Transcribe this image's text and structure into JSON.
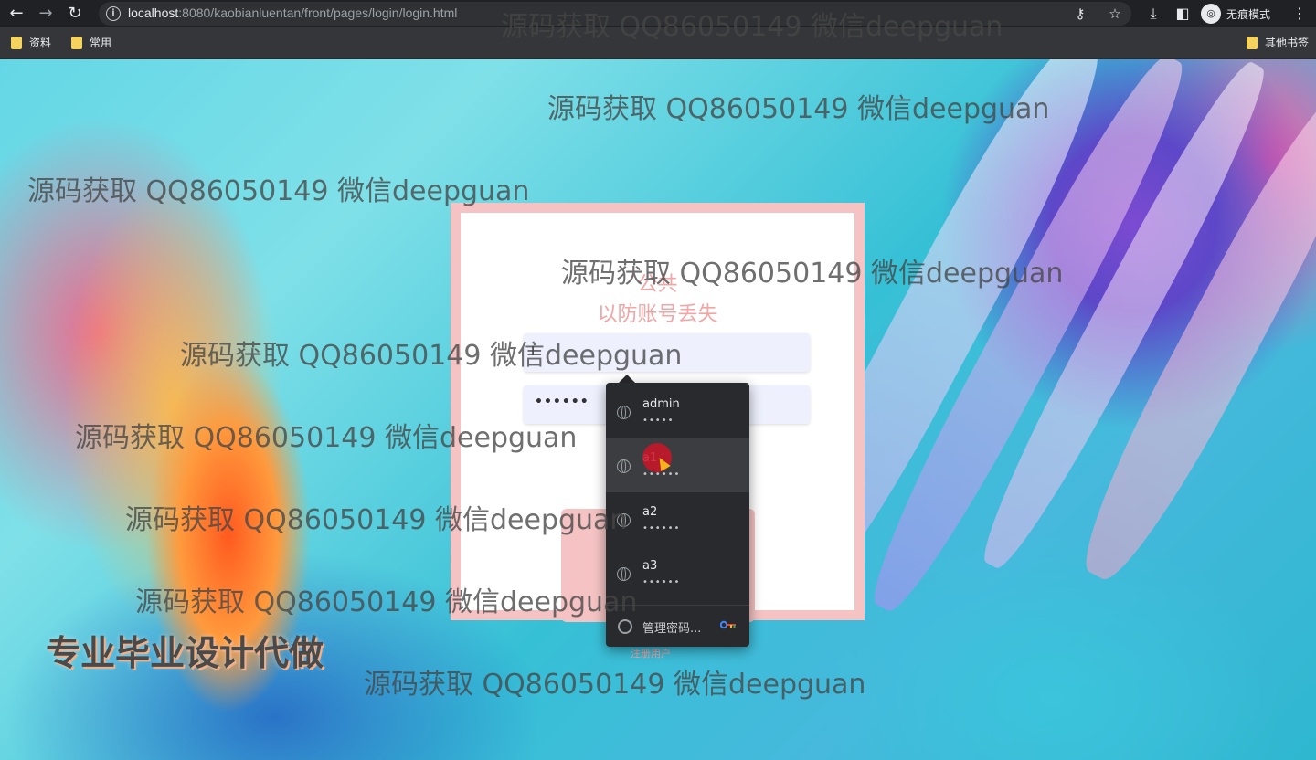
{
  "browser": {
    "url_host": "localhost",
    "url_rest": ":8080/kaobianluentan/front/pages/login/login.html",
    "incognito_label": "无痕模式",
    "bookmarks": [
      "资料",
      "常用"
    ],
    "other_bookmarks": "其他书签"
  },
  "login": {
    "notice_line1": "公共",
    "notice_line2": "以防账号丢失",
    "password_value": "••••••",
    "register_link": "注册用户"
  },
  "autofill": {
    "items": [
      {
        "user": "admin",
        "pass": "•••••"
      },
      {
        "user": "a1",
        "pass": "••••••"
      },
      {
        "user": "a2",
        "pass": "••••••"
      },
      {
        "user": "a3",
        "pass": "••••••"
      }
    ],
    "manage_label": "管理密码..."
  },
  "watermarks": [
    "源码获取 QQ86050149 微信deepguan",
    "源码获取 QQ86050149 微信deepguan",
    "源码获取 QQ86050149 微信deepguan",
    "源码获取 QQ86050149 微信deepguan",
    "源码获取 QQ86050149 微信deepguan",
    "源码获取 QQ86050149 微信deepguan",
    "源码获取 QQ86050149 微信deepguan",
    "源码获取 QQ86050149 微信deepguan",
    "源码获取 QQ86050149 微信deepguan"
  ],
  "promo": "专业毕业设计代做",
  "colors": {
    "card_pink": "#f5c3c3",
    "notice_pink": "#f3a5a5",
    "dropdown_bg": "#292a2d"
  }
}
